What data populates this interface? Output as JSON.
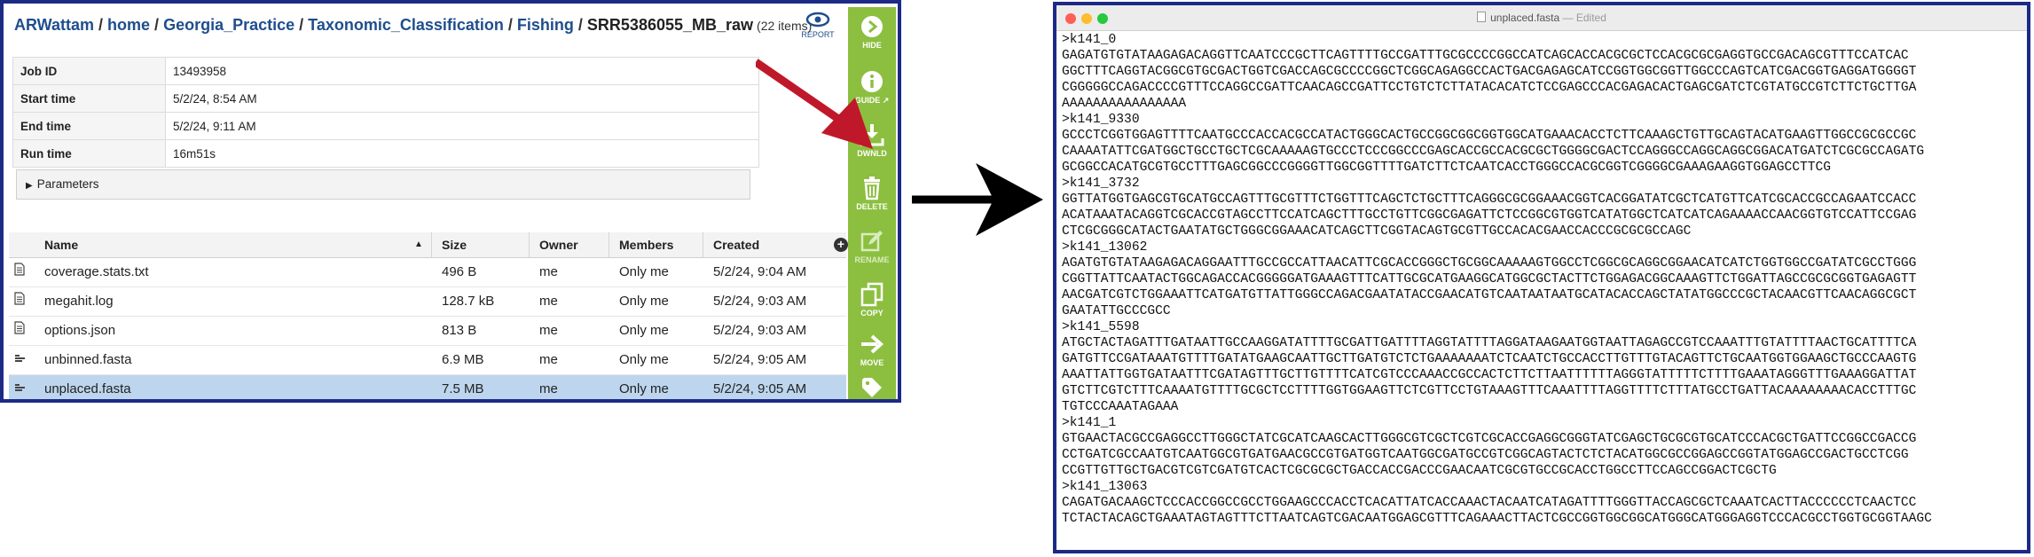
{
  "breadcrumb": {
    "items": [
      "ARWattam",
      "home",
      "Georgia_Practice",
      "Taxonomic_Classification",
      "Fishing"
    ],
    "current": "SRR5386055_MB_raw",
    "count": "(22 items)"
  },
  "report": {
    "label": "REPORT",
    "icon": "eye-icon"
  },
  "job_meta": [
    {
      "key": "Job ID",
      "value": "13493958"
    },
    {
      "key": "Start time",
      "value": "5/2/24, 8:54 AM"
    },
    {
      "key": "End time",
      "value": "5/2/24, 9:11 AM"
    },
    {
      "key": "Run time",
      "value": "16m51s"
    }
  ],
  "parameters_label": "Parameters",
  "file_table": {
    "headers": {
      "name": "Name",
      "size": "Size",
      "owner": "Owner",
      "members": "Members",
      "created": "Created"
    },
    "rows": [
      {
        "icon": "document-icon",
        "name": "coverage.stats.txt",
        "size": "496 B",
        "owner": "me",
        "members": "Only me",
        "created": "5/2/24, 9:04 AM"
      },
      {
        "icon": "document-icon",
        "name": "megahit.log",
        "size": "128.7 kB",
        "owner": "me",
        "members": "Only me",
        "created": "5/2/24, 9:03 AM"
      },
      {
        "icon": "document-icon",
        "name": "options.json",
        "size": "813 B",
        "owner": "me",
        "members": "Only me",
        "created": "5/2/24, 9:03 AM"
      },
      {
        "icon": "fasta-icon",
        "name": "unbinned.fasta",
        "size": "6.9 MB",
        "owner": "me",
        "members": "Only me",
        "created": "5/2/24, 9:05 AM"
      },
      {
        "icon": "fasta-icon",
        "name": "unplaced.fasta",
        "size": "7.5 MB",
        "owner": "me",
        "members": "Only me",
        "created": "5/2/24, 9:05 AM",
        "selected": true
      }
    ]
  },
  "action_bar": [
    {
      "label": "HIDE",
      "icon": "hide-icon"
    },
    {
      "label": "GUIDE",
      "icon": "info-icon"
    },
    {
      "label": "DWNLD",
      "icon": "download-icon"
    },
    {
      "label": "DELETE",
      "icon": "trash-icon"
    },
    {
      "label": "RENAME",
      "icon": "edit-icon",
      "disabled": true
    },
    {
      "label": "COPY",
      "icon": "copy-icon"
    },
    {
      "label": "MOVE",
      "icon": "move-icon"
    },
    {
      "label": "",
      "icon": "tag-icon"
    }
  ],
  "colors": {
    "action_bar": "#8cbf3f",
    "selected_row": "#bdd6ee",
    "frame": "#1c2a86",
    "arrow_red": "#c0182b"
  },
  "editor": {
    "title": "unplaced.fasta",
    "title_suffix": "— Edited",
    "lines": [
      ">k141_0",
      "GAGATGTGTATAAGAGACAGGTTCAATCCCGCTTCAGTTTTGCCGATTTGCGCCCCGGCCATCAGCACCACGCGCTCCACGCGCGAGGTGCCGACAGCGTTTCCATCAC",
      "GGCTTTCAGGTACGGCGTGCGACTGGTCGACCAGCGCCCCGGCTCGGCAGAGGCCACTGACGAGAGCATCCGGTGGCGGTTGGCCCAGTCATCGACGGTGAGGATGGGGT",
      "CGGGGGCCAGACCCCGTTTCCAGGCCGATTCAACAGCCGATTCCTGTCTCTTATACACATCTCCGAGCCCACGAGACACTGAGCGATCTCGTATGCCGTCTTCTGCTTGA",
      "AAAAAAAAAAAAAAAA",
      ">k141_9330",
      "GCCCTCGGTGGAGTTTTCAATGCCCACCACGCCATACTGGGCACTGCCGGCGGCGGTGGCATGAAACACCTCTTCAAAGCTGTTGCAGTACATGAAGTTGGCCGCGCCGC",
      "CAAAATATTCGATGGCTGCCTGCTCGCAAAAAGTGCCCTCCCGGCCCGAGCACCGCCACGCGCTGGGGCGACTCCAGGGCCAGGCAGGCGGACATGATCTCGCGCCAGATG",
      "GCGGCCACATGCGTGCCTTTGAGCGGCCCGGGGTTGGCGGTTTTGATCTTCTCAATCACCTGGGCCACGCGGTCGGGGCGAAAGAAGGTGGAGCCTTCG",
      ">k141_3732",
      "GGTTATGGTGAGCGTGCATGCCAGTTTGCGTTTCTGGTTTCAGCTCTGCTTTCAGGGCGCGGAAACGGTCACGGATATCGCTCATGTTCATCGCACCGCCAGAATCCACC",
      "ACATAAATACAGGTCGCACCGTAGCCTTCCATCAGCTTTGCCTGTTCGGCGAGATTCTCCGGCGTGGTCATATGGCTCATCATCAGAAAACCAACGGTGTCCATTCCGAG",
      "CTCGCGGGCATACTGAATATGCTGGGCGGAAACATCAGCTTCGGTACAGTGCGTTGCCACACGAACCACCCGCGCGCCAGC",
      ">k141_13062",
      "AGATGTGTATAAGAGACAGGAATTTGCCGCCATTAACATTCGCACCGGGCTGCGGCAAAAAGTGGCCTCGGCGCAGGCGGAACATCATCTGGTGGCCGATATCGCCTGGG",
      "CGGTTATTCAATACTGGCAGACCACGGGGGATGAAAGTTTCATTGCGCATGAAGGCATGGCGCTACTTCTGGAGACGGCAAAGTTCTGGATTAGCCGCGCGGTGAGAGTT",
      "AACGATCGTCTGGAAATTCATGATGTTATTGGGCCAGACGAATATACCGAACATGTCAATAATAATGCATACACCAGCTATATGGCCCGCTACAACGTTCAACAGGCGCT",
      "GAATATTGCCCGCC",
      ">k141_5598",
      "ATGCTACTAGATTTGATAATTGCCAAGGATATTTTGCGATTGATTTTAGGTATTTTAGGATAAGAATGGTAATTAGAGCCGTCCAAATTTGTATTTTAACTGCATTTTCA",
      "GATGTTCCGATAAATGTTTTGATATGAAGCAATTGCTTGATGTCTCTGAAAAAAATCTCAATCTGCCACCTTGTTTGTACAGTTCTGCAATGGTGGAAGCTGCCCAAGTG",
      "AAATTATTGGTGATAATTTCGATAGTTTGCTTGTTTTCATCGTCCCAAACCGCCACTCTTCTTAATTTTTTAGGGTATTTTTCTTTTGAAATAGGGTTTGAAAGGATTAT",
      "GTCTTCGTCTTTCAAAATGTTTTGCGCTCCTTTTGGTGGAAGTTCTCGTTCCTGTAAAGTTTCAAATTTTAGGTTTTCTTTATGCCTGATTACAAAAAAAACACCTTTGC",
      "TGTCCCAAATAGAAA",
      ">k141_1",
      "GTGAACTACGCCGAGGCCTTGGGCTATCGCATCAAGCACTTGGGCGTCGCTCGTCGCACCGAGGCGGGTATCGAGCTGCGCGTGCATCCCACGCTGATTCCGGCCGACCG",
      "CCTGATCGCCAATGTCAATGGCGTGATGAACGCCGTGATGGTCAATGGCGATGCCGTCGGCAGTACTCTCTACATGGCGCCGGAGCCGGTATGGAGCCGACTGCCTCGG",
      "CCGTTGTTGCTGACGTCGTCGATGTCACTCGCGCGCTGACCACCGACCCGAACAATCGCGTGCCGCACCTGGCCTTCCAGCCGGACTCGCTG",
      ">k141_13063",
      "CAGATGACAAGCTCCCACCGGCCGCCTGGAAGCCCACCTCACATTATCACCAAACTACAATCATAGATTTTGGGTTACCAGCGCTCAAATCACTTACCCCCCTCAACTCC",
      "TCTACTACAGCTGAAATAGTAGTTTCTTAATCAGTCGACAATGGAGCGTTTCAGAAACTTACTCGCCGGTGGCGGCATGGGCATGGGAGGTCCCACGCCTGGTGCGGTAAGC"
    ]
  }
}
